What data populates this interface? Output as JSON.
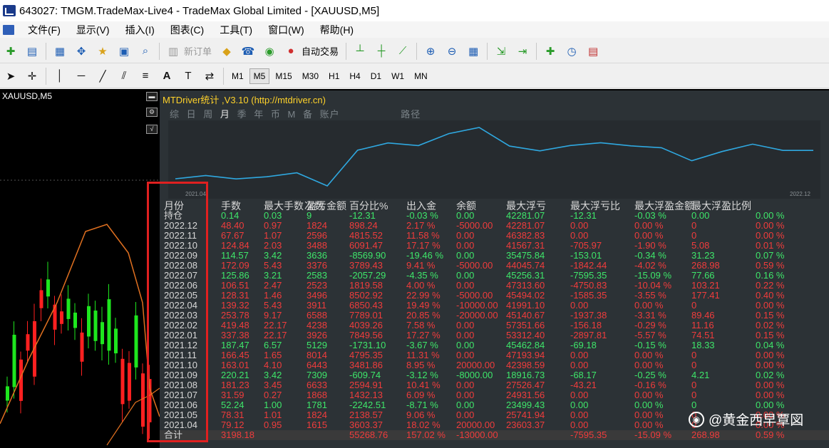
{
  "window": {
    "title": "643027: TMGM.TradeMax-Live4 - TradeMax Global Limited - [XAUUSD,M5]"
  },
  "menu": [
    "文件(F)",
    "显示(V)",
    "插入(I)",
    "图表(C)",
    "工具(T)",
    "窗口(W)",
    "帮助(H)"
  ],
  "toolbar1": {
    "new_order": "新订单",
    "auto_trade": "自动交易"
  },
  "toolbar2": {
    "timeframes": [
      "M1",
      "M5",
      "M15",
      "M30",
      "H1",
      "H4",
      "D1",
      "W1",
      "MN"
    ],
    "active": "M5",
    "text_tool": "A"
  },
  "chart": {
    "symbol": "XAUUSD,M5"
  },
  "panel": {
    "title": "MTDriver统计 ,V3.10 (http://mtdriver.cn)",
    "tabs": [
      "综",
      "日",
      "周",
      "月",
      "季",
      "年",
      "币",
      "M",
      "备",
      "账户"
    ],
    "active_tab": "月",
    "route_tab": "路径",
    "curve_start": "2021.04",
    "curve_end": "2022.12",
    "balance_curve": [
      23603.37,
      25741.94,
      23499.43,
      24931.56,
      27526.47,
      18916.73,
      42398.59,
      47193.94,
      45462.84,
      53312.4,
      57351.66,
      45140.67,
      41991.1,
      45494.02,
      47313.6,
      45256.31,
      44045.74,
      35475.84,
      41567.31,
      46382.83,
      42281.07,
      42281.07
    ],
    "headers": [
      "月份",
      "手数",
      "最大手数",
      "次数",
      "盈亏金额",
      "百分比%",
      "出入金",
      "余额",
      "最大浮亏",
      "最大浮亏比",
      "最大浮盈金额",
      "最大浮盈比例"
    ],
    "rows": [
      {
        "m": "持仓",
        "c": "g",
        "v": [
          "0.14",
          "0.03",
          "9",
          "-12.31",
          "-0.03 %",
          "0.00",
          "42281.07",
          "-12.31",
          "-0.03 %",
          "0.00",
          "0.00 %"
        ]
      },
      {
        "m": "2022.12",
        "c": "r",
        "v": [
          "48.40",
          "0.97",
          "1824",
          "898.24",
          "2.17 %",
          "-5000.00",
          "42281.07",
          "0.00",
          "0.00 %",
          "0",
          "0.00 %"
        ]
      },
      {
        "m": "2022.11",
        "c": "r",
        "v": [
          "67.67",
          "1.07",
          "2596",
          "4815.52",
          "11.58 %",
          "0.00",
          "46382.83",
          "0.00",
          "0.00 %",
          "0",
          "0.00 %"
        ]
      },
      {
        "m": "2022.10",
        "c": "r",
        "v": [
          "124.84",
          "2.03",
          "3488",
          "6091.47",
          "17.17 %",
          "0.00",
          "41567.31",
          "-705.97",
          "-1.90 %",
          "5.08",
          "0.01 %"
        ]
      },
      {
        "m": "2022.09",
        "c": "g",
        "v": [
          "114.57",
          "3.42",
          "3636",
          "-8569.90",
          "-19.46 %",
          "0.00",
          "35475.84",
          "-153.01",
          "-0.34 %",
          "31.23",
          "0.07 %"
        ]
      },
      {
        "m": "2022.08",
        "c": "r",
        "v": [
          "172.09",
          "5.43",
          "3376",
          "3789.43",
          "9.41 %",
          "-5000.00",
          "44045.74",
          "-1842.44",
          "-4.02 %",
          "268.98",
          "0.59 %"
        ]
      },
      {
        "m": "2022.07",
        "c": "g",
        "v": [
          "125.86",
          "3.21",
          "2583",
          "-2057.29",
          "-4.35 %",
          "0.00",
          "45256.31",
          "-7595.35",
          "-15.09 %",
          "77.66",
          "0.16 %"
        ]
      },
      {
        "m": "2022.06",
        "c": "r",
        "v": [
          "106.51",
          "2.47",
          "2523",
          "1819.58",
          "4.00 %",
          "0.00",
          "47313.60",
          "-4750.83",
          "-10.04 %",
          "103.21",
          "0.22 %"
        ]
      },
      {
        "m": "2022.05",
        "c": "r",
        "v": [
          "128.31",
          "1.46",
          "3496",
          "8502.92",
          "22.99 %",
          "-5000.00",
          "45494.02",
          "-1585.35",
          "-3.55 %",
          "177.41",
          "0.40 %"
        ]
      },
      {
        "m": "2022.04",
        "c": "r",
        "v": [
          "139.32",
          "5.43",
          "3911",
          "6850.43",
          "19.49 %",
          "-10000.00",
          "41991.10",
          "0.00",
          "0.00 %",
          "0",
          "0.00 %"
        ]
      },
      {
        "m": "2022.03",
        "c": "r",
        "v": [
          "253.78",
          "9.17",
          "6588",
          "7789.01",
          "20.85 %",
          "-20000.00",
          "45140.67",
          "-1937.38",
          "-3.31 %",
          "89.46",
          "0.15 %"
        ]
      },
      {
        "m": "2022.02",
        "c": "r",
        "v": [
          "419.48",
          "22.17",
          "4238",
          "4039.26",
          "7.58 %",
          "0.00",
          "57351.66",
          "-156.18",
          "-0.29 %",
          "11.16",
          "0.02 %"
        ]
      },
      {
        "m": "2022.01",
        "c": "r",
        "v": [
          "337.38",
          "22.17",
          "3926",
          "7849.56",
          "17.27 %",
          "0.00",
          "53312.40",
          "-2897.81",
          "-5.57 %",
          "74.51",
          "0.15 %"
        ]
      },
      {
        "m": "2021.12",
        "c": "g",
        "v": [
          "187.47",
          "6.57",
          "5129",
          "-1731.10",
          "-3.67 %",
          "0.00",
          "45462.84",
          "-69.18",
          "-0.15 %",
          "18.33",
          "0.04 %"
        ]
      },
      {
        "m": "2021.11",
        "c": "r",
        "v": [
          "166.45",
          "1.65",
          "8014",
          "4795.35",
          "11.31 %",
          "0.00",
          "47193.94",
          "0.00",
          "0.00 %",
          "0",
          "0.00 %"
        ]
      },
      {
        "m": "2021.10",
        "c": "r",
        "v": [
          "163.01",
          "4.10",
          "6443",
          "3481.86",
          "8.95 %",
          "20000.00",
          "42398.59",
          "0.00",
          "0.00 %",
          "0",
          "0.00 %"
        ]
      },
      {
        "m": "2021.09",
        "c": "g",
        "v": [
          "220.21",
          "3.42",
          "7309",
          "-609.74",
          "-3.12 %",
          "-8000.00",
          "18916.73",
          "-68.17",
          "-0.25 %",
          "4.21",
          "0.02 %"
        ]
      },
      {
        "m": "2021.08",
        "c": "r",
        "v": [
          "181.23",
          "3.45",
          "6633",
          "2594.91",
          "10.41 %",
          "0.00",
          "27526.47",
          "-43.21",
          "-0.16 %",
          "0",
          "0.00 %"
        ]
      },
      {
        "m": "2021.07",
        "c": "r",
        "v": [
          "31.59",
          "0.27",
          "1868",
          "1432.13",
          "6.09 %",
          "0.00",
          "24931.56",
          "0.00",
          "0.00 %",
          "0",
          "0.00 %"
        ]
      },
      {
        "m": "2021.06",
        "c": "g",
        "v": [
          "52.24",
          "1.00",
          "1781",
          "-2242.51",
          "-8.71 %",
          "0.00",
          "23499.43",
          "0.00",
          "0.00 %",
          "0",
          "0.00 %"
        ]
      },
      {
        "m": "2021.05",
        "c": "r",
        "v": [
          "78.31",
          "1.01",
          "1824",
          "2138.57",
          "9.06 %",
          "0.00",
          "25741.94",
          "0.00",
          "0.00 %",
          "0",
          "0.00 %"
        ]
      },
      {
        "m": "2021.04",
        "c": "r",
        "v": [
          "79.12",
          "0.95",
          "1615",
          "3603.37",
          "18.02 %",
          "20000.00",
          "23603.37",
          "0.00",
          "0.00 %",
          "0",
          "0.00 %"
        ]
      }
    ],
    "total": {
      "m": "合计",
      "v": [
        "3198.18",
        "",
        "",
        "55268.76",
        "157.02 %",
        "-13000.00",
        "",
        "-7595.35",
        "-15.09 %",
        "268.98",
        "0.59 %"
      ]
    }
  },
  "watermark": "@黄金西早覃図"
}
